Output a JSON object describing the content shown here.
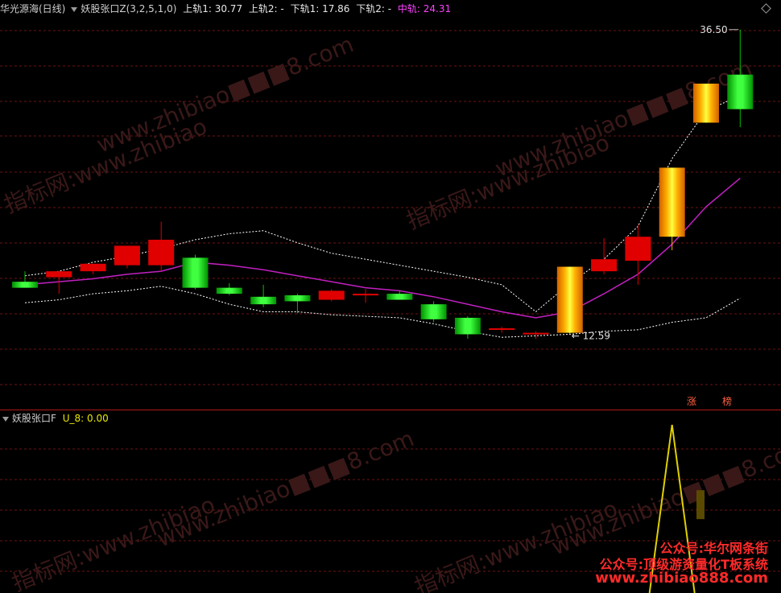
{
  "main_header": {
    "title": "华光源海(日线)",
    "indicator": "妖股张口Z(3,2,5,1,0)",
    "upper1": "上轨1: 30.77",
    "upper2": "上轨2: -",
    "lower1": "下轨1: 17.86",
    "lower2": "下轨2: -",
    "middle": "中轨: 24.31"
  },
  "sub_header": {
    "indicator": "妖股张口F",
    "value": "U_8: 0.00"
  },
  "colors": {
    "up": "#e00000",
    "down": "#00c000",
    "limit_up_gold": "#ffa500",
    "middle_line": "#c020c0",
    "band": "#ffffff",
    "grid": "#6e1212",
    "signal": "#e0d000",
    "indicator_magenta": "#ff40ff"
  },
  "chart_data": [
    {
      "type": "candlestick",
      "title": "华光源海(日线)",
      "ylim": [
        11.5,
        37.5
      ],
      "grid": true,
      "candles": [
        {
          "o": 19.8,
          "h": 20.5,
          "l": 19.5,
          "c": 19.4
        },
        {
          "o": 20.1,
          "h": 20.4,
          "l": 19.0,
          "c": 20.5
        },
        {
          "o": 20.5,
          "h": 21.0,
          "l": 20.3,
          "c": 21.0
        },
        {
          "o": 20.9,
          "h": 21.7,
          "l": 20.7,
          "c": 22.2
        },
        {
          "o": 20.9,
          "h": 23.8,
          "l": 20.5,
          "c": 22.6
        },
        {
          "o": 21.4,
          "h": 21.6,
          "l": 19.3,
          "c": 19.4
        },
        {
          "o": 19.4,
          "h": 19.7,
          "l": 18.9,
          "c": 19.0
        },
        {
          "o": 18.8,
          "h": 19.6,
          "l": 18.1,
          "c": 18.3
        },
        {
          "o": 18.9,
          "h": 19.0,
          "l": 17.7,
          "c": 18.5
        },
        {
          "o": 18.6,
          "h": 19.3,
          "l": 18.5,
          "c": 19.2
        },
        {
          "o": 19.0,
          "h": 19.3,
          "l": 18.4,
          "c": 19.0
        },
        {
          "o": 19.0,
          "h": 19.2,
          "l": 18.6,
          "c": 18.6
        },
        {
          "o": 18.3,
          "h": 18.5,
          "l": 17.1,
          "c": 17.3
        },
        {
          "o": 17.4,
          "h": 17.5,
          "l": 16.0,
          "c": 16.3
        },
        {
          "o": 16.6,
          "h": 16.8,
          "l": 16.4,
          "c": 16.7
        },
        {
          "o": 16.3,
          "h": 16.5,
          "l": 16.0,
          "c": 16.4
        },
        {
          "o": 16.4,
          "h": 20.8,
          "l": 16.3,
          "c": 20.8,
          "limit_up": true
        },
        {
          "o": 20.5,
          "h": 22.7,
          "l": 20.3,
          "c": 21.3
        },
        {
          "o": 21.2,
          "h": 23.6,
          "l": 19.6,
          "c": 22.8
        },
        {
          "o": 22.8,
          "h": 27.4,
          "l": 21.9,
          "c": 27.4,
          "limit_up": true
        },
        {
          "o": 30.4,
          "h": 33.0,
          "l": 30.4,
          "c": 33.0,
          "limit_up": true
        },
        {
          "o": 33.6,
          "h": 36.6,
          "l": 30.1,
          "c": 31.3
        }
      ],
      "middle_line": [
        19.6,
        19.8,
        20.0,
        20.3,
        20.5,
        21.1,
        20.9,
        20.6,
        20.2,
        19.8,
        19.4,
        19.2,
        18.8,
        18.3,
        17.8,
        17.4,
        17.8,
        19.0,
        20.3,
        22.3,
        24.8,
        26.7
      ],
      "upper_band": [
        20.2,
        20.5,
        21.1,
        21.5,
        22.0,
        22.6,
        23.0,
        23.2,
        22.4,
        21.7,
        21.3,
        20.9,
        20.5,
        20.1,
        19.6,
        17.8,
        19.7,
        21.3,
        23.5,
        28.0,
        31.2,
        32.2
      ],
      "lower_band": [
        18.4,
        18.6,
        19.0,
        19.2,
        19.5,
        19.0,
        18.3,
        17.8,
        17.8,
        17.6,
        17.5,
        17.4,
        17.0,
        16.5,
        16.1,
        16.2,
        16.3,
        16.5,
        16.6,
        17.1,
        17.4,
        18.7
      ],
      "annotations": [
        {
          "text": "36.50",
          "candle": 21,
          "value": 36.6
        },
        {
          "text": "← 12.59",
          "candle": 16,
          "value": 16.3
        }
      ],
      "labels_bottom": [
        "涨",
        "榜"
      ]
    },
    {
      "type": "line",
      "title": "妖股张口F",
      "ylim": [
        0,
        1
      ],
      "signal_spike": {
        "candle": 19,
        "value": 1
      },
      "marker": {
        "candle": 20,
        "value": 0.6
      }
    }
  ],
  "watermark": {
    "site": "www.zhibiao",
    "suffix": "8.com",
    "brand": "指标网:"
  },
  "promo": {
    "line1": "公众号:华尔网条街",
    "line2": "公众号:顶级游资量化T板系统",
    "line3": "www.zhibiao888.com"
  }
}
